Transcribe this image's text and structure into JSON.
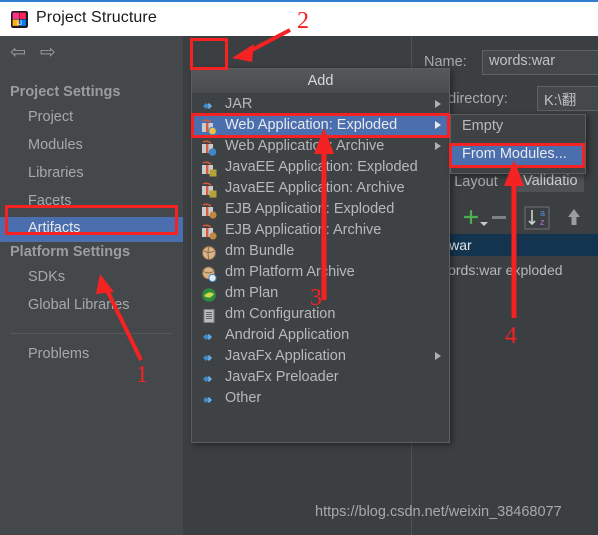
{
  "window": {
    "title": "Project Structure",
    "icon": "intellij-idea-icon"
  },
  "sidebar": {
    "nav": {
      "back": "⇦",
      "forward": "⇨"
    },
    "add_button": "+",
    "groups": [
      {
        "label": "Project Settings",
        "items": [
          "Project",
          "Modules",
          "Libraries",
          "Facets",
          "Artifacts"
        ],
        "selected": "Artifacts"
      },
      {
        "label": "Platform Settings",
        "items": [
          "SDKs",
          "Global Libraries"
        ]
      }
    ],
    "problems": "Problems"
  },
  "menu": {
    "header": "Add",
    "items": [
      {
        "label": "JAR",
        "icon": "diamond-blue-icon",
        "submenu": true,
        "selected": false
      },
      {
        "label": "Web Application: Exploded",
        "icon": "web-gift-icon",
        "submenu": true,
        "selected": true
      },
      {
        "label": "Web Application: Archive",
        "icon": "web-gift-icon",
        "submenu": true,
        "selected": false
      },
      {
        "label": "JavaEE Application: Exploded",
        "icon": "javaee-gift-icon",
        "submenu": false,
        "selected": false
      },
      {
        "label": "JavaEE Application: Archive",
        "icon": "javaee-gift-icon",
        "submenu": false,
        "selected": false
      },
      {
        "label": "EJB Application: Exploded",
        "icon": "ejb-gift-icon",
        "submenu": false,
        "selected": false
      },
      {
        "label": "EJB Application: Archive",
        "icon": "ejb-gift-icon",
        "submenu": false,
        "selected": false
      },
      {
        "label": "dm Bundle",
        "icon": "dm-bundle-icon",
        "submenu": false,
        "selected": false
      },
      {
        "label": "dm Platform Archive",
        "icon": "dm-platform-icon",
        "submenu": false,
        "selected": false
      },
      {
        "label": "dm Plan",
        "icon": "dm-plan-icon",
        "submenu": false,
        "selected": false
      },
      {
        "label": "dm Configuration",
        "icon": "dm-config-icon",
        "submenu": false,
        "selected": false
      },
      {
        "label": "Android Application",
        "icon": "diamond-blue-icon",
        "submenu": false,
        "selected": false
      },
      {
        "label": "JavaFx Application",
        "icon": "diamond-blue-icon",
        "submenu": true,
        "selected": false
      },
      {
        "label": "JavaFx Preloader",
        "icon": "diamond-blue-icon",
        "submenu": false,
        "selected": false
      },
      {
        "label": "Other",
        "icon": "diamond-blue-icon",
        "submenu": false,
        "selected": false
      }
    ]
  },
  "submenu": {
    "items": [
      {
        "label": "Empty",
        "selected": false
      },
      {
        "label": "From Modules...",
        "selected": true
      }
    ]
  },
  "right_panel": {
    "name_label": "Name:",
    "name_value": "words:war",
    "output_dir_label": "put directory:",
    "output_dir_value": "K:\\翻",
    "tabs": [
      {
        "label": "tput Layout",
        "active": false
      },
      {
        "label": "Validatio",
        "active": true
      }
    ],
    "toolbar": {
      "include_icon": "file-include-icon",
      "add": "+",
      "remove": "−",
      "sort": "sort-az-icon",
      "move_up": "arrow-up-icon"
    },
    "tree": [
      {
        "label": "ords.war",
        "selected": true,
        "icon": ""
      },
      {
        "label": "words:war exploded",
        "selected": false,
        "icon": "artifact-icon"
      }
    ]
  },
  "annotations": {
    "numbers": [
      "1",
      "2",
      "3",
      "4"
    ],
    "color": "#f42222"
  },
  "watermark": "https://blog.csdn.net/weixin_38468077"
}
